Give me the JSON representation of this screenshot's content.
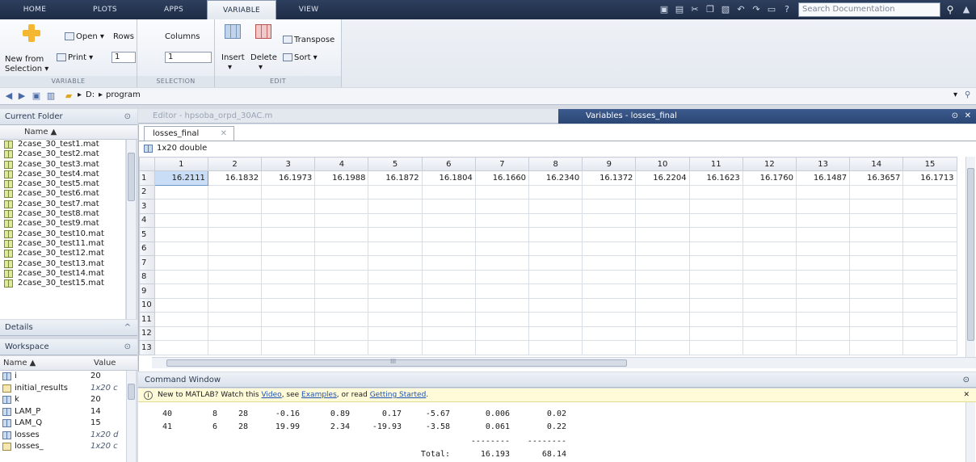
{
  "tabs": [
    "HOME",
    "PLOTS",
    "APPS",
    "VARIABLE",
    "VIEW"
  ],
  "search": {
    "placeholder": "Search Documentation"
  },
  "ribbon": {
    "new_from": "New from",
    "selection": "Selection ▾",
    "open": "Open ▾",
    "print": "Print ▾",
    "rows_label": "Rows",
    "columns_label": "Columns",
    "rows_value": "1",
    "columns_value": "1",
    "insert": "Insert",
    "delete": "Delete",
    "transpose": "Transpose",
    "sort": "Sort ▾",
    "group_variable": "VARIABLE",
    "group_selection": "SELECTION",
    "group_edit": "EDIT"
  },
  "address": {
    "drive": "D:",
    "folder": "program"
  },
  "current_folder": {
    "title": "Current Folder",
    "name_col": "Name ▲",
    "files": [
      "2case_30_test1.mat",
      "2case_30_test2.mat",
      "2case_30_test3.mat",
      "2case_30_test4.mat",
      "2case_30_test5.mat",
      "2case_30_test6.mat",
      "2case_30_test7.mat",
      "2case_30_test8.mat",
      "2case_30_test9.mat",
      "2case_30_test10.mat",
      "2case_30_test11.mat",
      "2case_30_test12.mat",
      "2case_30_test13.mat",
      "2case_30_test14.mat",
      "2case_30_test15.mat"
    ]
  },
  "details": {
    "title": "Details"
  },
  "workspace": {
    "title": "Workspace",
    "name_col": "Name ▲",
    "value_col": "Value",
    "items": [
      {
        "name": "i",
        "value": "20",
        "italic": false,
        "icon": "matrix"
      },
      {
        "name": "initial_results",
        "value": "1x20 c",
        "italic": true,
        "icon": "struct"
      },
      {
        "name": "k",
        "value": "20",
        "italic": false,
        "icon": "matrix"
      },
      {
        "name": "LAM_P",
        "value": "14",
        "italic": false,
        "icon": "matrix"
      },
      {
        "name": "LAM_Q",
        "value": "15",
        "italic": false,
        "icon": "matrix"
      },
      {
        "name": "losses",
        "value": "1x20 d",
        "italic": true,
        "icon": "matrix"
      },
      {
        "name": "losses_",
        "value": "1x20 c",
        "italic": true,
        "icon": "struct"
      }
    ]
  },
  "editor": {
    "tab": "Editor - hpsoba_orpd_30AC.m"
  },
  "variables": {
    "title": "Variables - losses_final",
    "tab": "losses_final",
    "size": "1x20 double",
    "columns": [
      "1",
      "2",
      "3",
      "4",
      "5",
      "6",
      "7",
      "8",
      "9",
      "10",
      "11",
      "12",
      "13",
      "14",
      "15"
    ],
    "rows": [
      "1",
      "2",
      "3",
      "4",
      "5",
      "6",
      "7",
      "8",
      "9",
      "10",
      "11",
      "12",
      "13"
    ],
    "values": [
      "16.2111",
      "16.1832",
      "16.1973",
      "16.1988",
      "16.1872",
      "16.1804",
      "16.1660",
      "16.2340",
      "16.1372",
      "16.2204",
      "16.1623",
      "16.1760",
      "16.1487",
      "16.3657",
      "16.1713"
    ],
    "scroll_center": "III"
  },
  "command_window": {
    "title": "Command Window",
    "info_prefix": "New to MATLAB? Watch this ",
    "info_video": "Video",
    "info_mid1": ", see ",
    "info_examples": "Examples",
    "info_mid2": ", or read ",
    "info_started": "Getting Started",
    "info_end": ".",
    "rows": [
      [
        "40",
        "8",
        "28",
        "-0.16",
        "0.89",
        "0.17",
        "-5.67",
        "0.006",
        "0.02"
      ],
      [
        "41",
        "6",
        "28",
        "19.99",
        "2.34",
        "-19.93",
        "-3.58",
        "0.061",
        "0.22"
      ]
    ],
    "dashes": [
      "--------",
      "--------"
    ],
    "total_label": "Total:",
    "totals": [
      "16.193",
      "68.14"
    ]
  }
}
